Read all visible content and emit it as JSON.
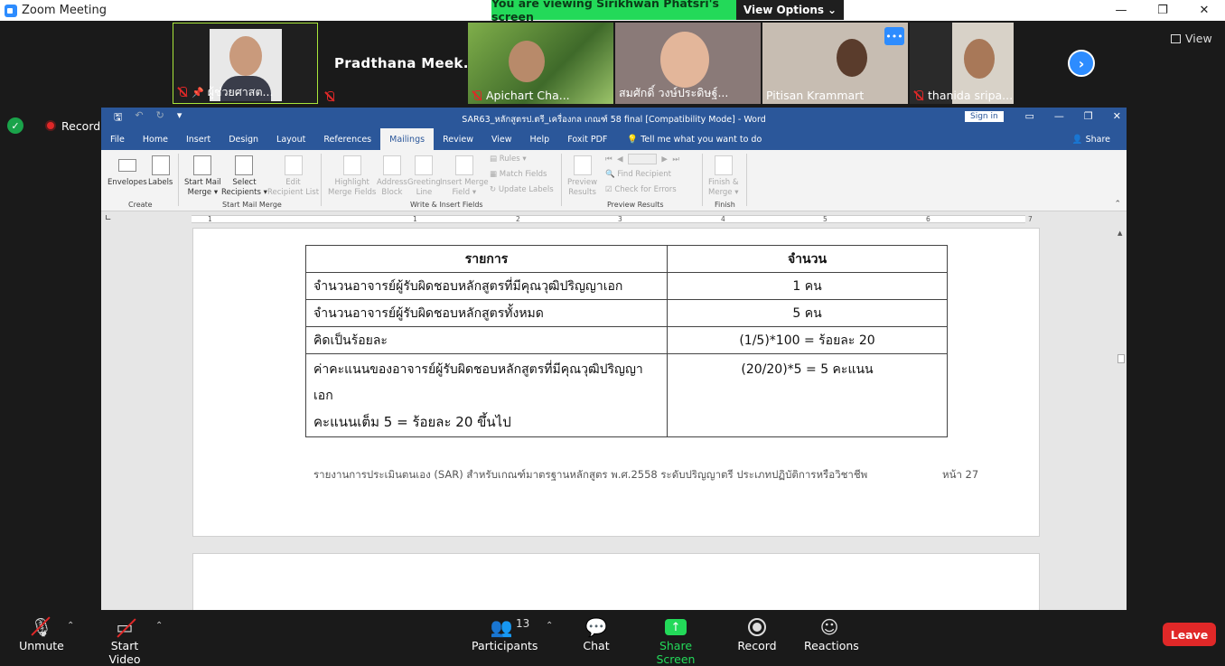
{
  "zoom": {
    "title": "Zoom Meeting",
    "banner": "You are viewing Sirikhwan Phatsri's screen",
    "view_options": "View Options",
    "view_label": "View",
    "recording": "Recording",
    "win_min": "—",
    "win_max": "❐",
    "win_close": "✕"
  },
  "participants": [
    {
      "name": "ผู้ช่วยศาสต..."
    },
    {
      "name": "Pradthana   Meek..."
    },
    {
      "name": "Apichart Cha..."
    },
    {
      "name": "สมศักดิ์ วงษ์ประดิษฐ์..."
    },
    {
      "name": "Pitisan Krammart"
    },
    {
      "name": "thanida sripa..."
    }
  ],
  "word": {
    "doc_title": "SAR63_หลักสูตรป.ตรี_เครื่องกล เกณฑ์ 58 final [Compatibility Mode]  -  Word",
    "sign_in": "Sign in",
    "share": "Share",
    "tell_me": "Tell me what you want to do",
    "tabs": [
      "File",
      "Home",
      "Insert",
      "Design",
      "Layout",
      "References",
      "Mailings",
      "Review",
      "View",
      "Help",
      "Foxit PDF"
    ],
    "ribbon": {
      "envelopes": "Envelopes",
      "labels": "Labels",
      "create": "Create",
      "start_mail_merge_a": "Start Mail",
      "start_mail_merge_b": "Merge",
      "select_recipients_a": "Select",
      "select_recipients_b": "Recipients",
      "edit_recipient_a": "Edit",
      "edit_recipient_b": "Recipient List",
      "group_start": "Start Mail Merge",
      "highlight_a": "Highlight",
      "highlight_b": "Merge Fields",
      "address_a": "Address",
      "address_b": "Block",
      "greeting_a": "Greeting",
      "greeting_b": "Line",
      "insert_merge_a": "Insert Merge",
      "insert_merge_b": "Field",
      "rules": "Rules",
      "match_fields": "Match Fields",
      "update_labels": "Update Labels",
      "group_write": "Write & Insert Fields",
      "preview_a": "Preview",
      "preview_b": "Results",
      "find_recipient": "Find Recipient",
      "check_errors": "Check for Errors",
      "group_preview": "Preview Results",
      "finish_a": "Finish &",
      "finish_b": "Merge",
      "group_finish": "Finish"
    },
    "ruler_marks": [
      "1",
      "1",
      "2",
      "3",
      "4",
      "5",
      "6",
      "7"
    ],
    "table": {
      "headers": [
        "รายการ",
        "จำนวน"
      ],
      "rows": [
        [
          "จำนวนอาจารย์ผู้รับผิดชอบหลักสูตรที่มีคุณวุฒิปริญญาเอก",
          "1 คน"
        ],
        [
          "จำนวนอาจารย์ผู้รับผิดชอบหลักสูตรทั้งหมด",
          "5 คน"
        ],
        [
          "คิดเป็นร้อยละ",
          "(1/5)*100 = ร้อยละ 20"
        ]
      ],
      "last_row_line1": "ค่าคะแนนของอาจารย์ผู้รับผิดชอบหลักสูตรที่มีคุณวุฒิปริญญาเอก",
      "last_row_line2": "คะแนนเต็ม 5 = ร้อยละ 20 ขึ้นไป",
      "last_row_value": "(20/20)*5 = 5 คะแนน"
    },
    "footer": "รายงานการประเมินตนเอง (SAR) สำหรับเกณฑ์มาตรฐานหลักสูตร พ.ศ.2558 ระดับปริญญาตรี ประเภทปฏิบัติการหรือวิชาชีพ",
    "page_number": "หน้า 27"
  },
  "toolbar": {
    "unmute": "Unmute",
    "start_video": "Start Video",
    "participants": "Participants",
    "participant_count": "13",
    "chat": "Chat",
    "share_screen": "Share Screen",
    "record": "Record",
    "reactions": "Reactions",
    "leave": "Leave"
  },
  "colors": {
    "word_blue": "#2b579a",
    "share_green": "#23d959",
    "zoom_blue": "#2d8cff",
    "leave_red": "#e02828"
  }
}
